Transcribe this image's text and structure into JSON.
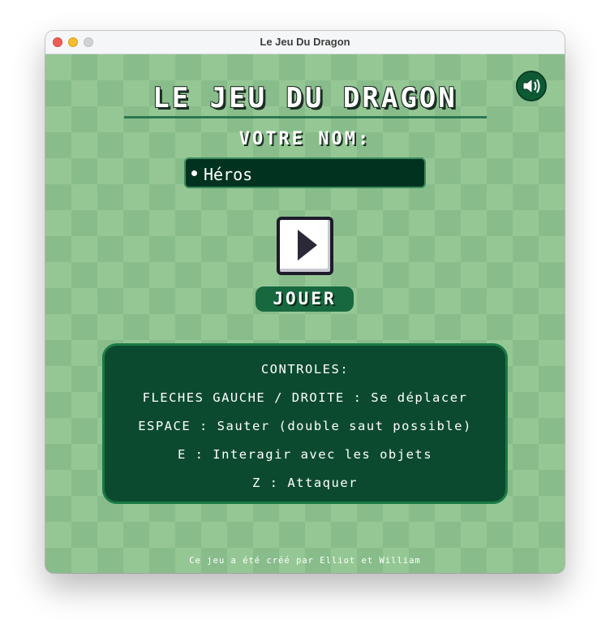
{
  "window": {
    "title": "Le Jeu Du Dragon"
  },
  "game": {
    "title": "LE JEU DU DRAGON",
    "name_label": "VOTRE NOM:",
    "name_value": "Héros",
    "play_label": "JOUER",
    "controls": {
      "heading": "CONTROLES:",
      "lines": [
        "FLECHES GAUCHE / DROITE : Se déplacer",
        "ESPACE : Sauter (double saut possible)",
        "E : Interagir avec les objets",
        "Z : Attaquer"
      ]
    },
    "credits": "Ce jeu a été créé par Elliot et William"
  },
  "icons": {
    "sound": "speaker-volume-icon",
    "play": "play-triangle-icon"
  },
  "colors": {
    "background": "#95c795",
    "panel": "#0c4a30",
    "panel_border": "#1a7a44",
    "accent": "#17683e",
    "input_bg": "#003220"
  }
}
